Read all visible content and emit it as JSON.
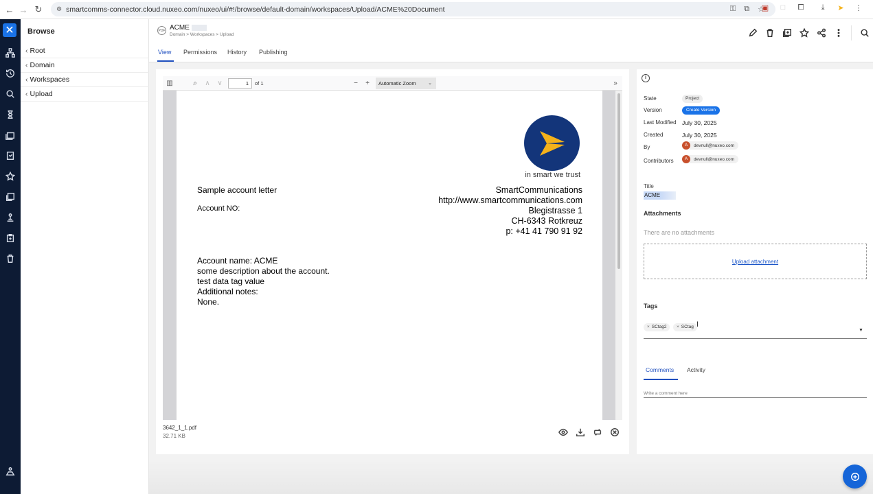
{
  "browser": {
    "url": "smartcomms-connector.cloud.nuxeo.com/nuxeo/ui/#!/browse/default-domain/workspaces/Upload/ACME%20Document"
  },
  "drawer": {
    "title": "Browse",
    "items": [
      {
        "label": "Root"
      },
      {
        "label": "Domain"
      },
      {
        "label": "Workspaces"
      },
      {
        "label": "Upload"
      }
    ]
  },
  "document": {
    "type_badge": "PDF",
    "title": "ACME",
    "breadcrumb": "Domain > Workspaces > Upload"
  },
  "tabs": [
    {
      "label": "View"
    },
    {
      "label": "Permissions"
    },
    {
      "label": "History"
    },
    {
      "label": "Publishing"
    }
  ],
  "pdf_viewer": {
    "page": "1",
    "of_pages": "of 1",
    "zoom": "Automatic Zoom",
    "tagline": "in smart we trust",
    "letter": {
      "heading": "Sample account letter",
      "account_no": "Account NO:",
      "company": "SmartCommunications",
      "website": "http://www.smartcommunications.com",
      "street": "Blegistrasse 1",
      "city": "CH-6343 Rotkreuz",
      "phone": "p: +41 41 790 91 92",
      "body": [
        "Account name: ACME",
        "some description about the account.",
        "test data tag value",
        "Additional notes:",
        "None."
      ]
    },
    "file_name": "3642_1_1.pdf",
    "file_size": "32.71 KB"
  },
  "metadata": {
    "state_label": "State",
    "state_value": "Project",
    "version_label": "Version",
    "version_button": "Create Version",
    "last_modified_label": "Last Modified",
    "last_modified_value": "July 30, 2025",
    "created_label": "Created",
    "created_value": "July 30, 2025",
    "by_label": "By",
    "by_avatar": "A",
    "by_user": "devnull@nuxeo.com",
    "contributors_label": "Contributors",
    "contributors_avatar": "A",
    "contributors_user": "devnull@nuxeo.com",
    "title_label": "Title",
    "title_value": "ACME"
  },
  "attachments": {
    "heading": "Attachments",
    "empty": "There are no attachments",
    "upload_link": "Upload attachment"
  },
  "tags": {
    "heading": "Tags",
    "items": [
      "SCtag2",
      "SCtag"
    ]
  },
  "comments": {
    "tabs": [
      "Comments",
      "Activity"
    ],
    "placeholder": "Write a comment here"
  },
  "colors": {
    "accent": "#1f4fbf",
    "appbar": "#0d1b34",
    "fab": "#1565d8",
    "logo": "#13357a",
    "logo_arrow": "#f5b21a"
  }
}
